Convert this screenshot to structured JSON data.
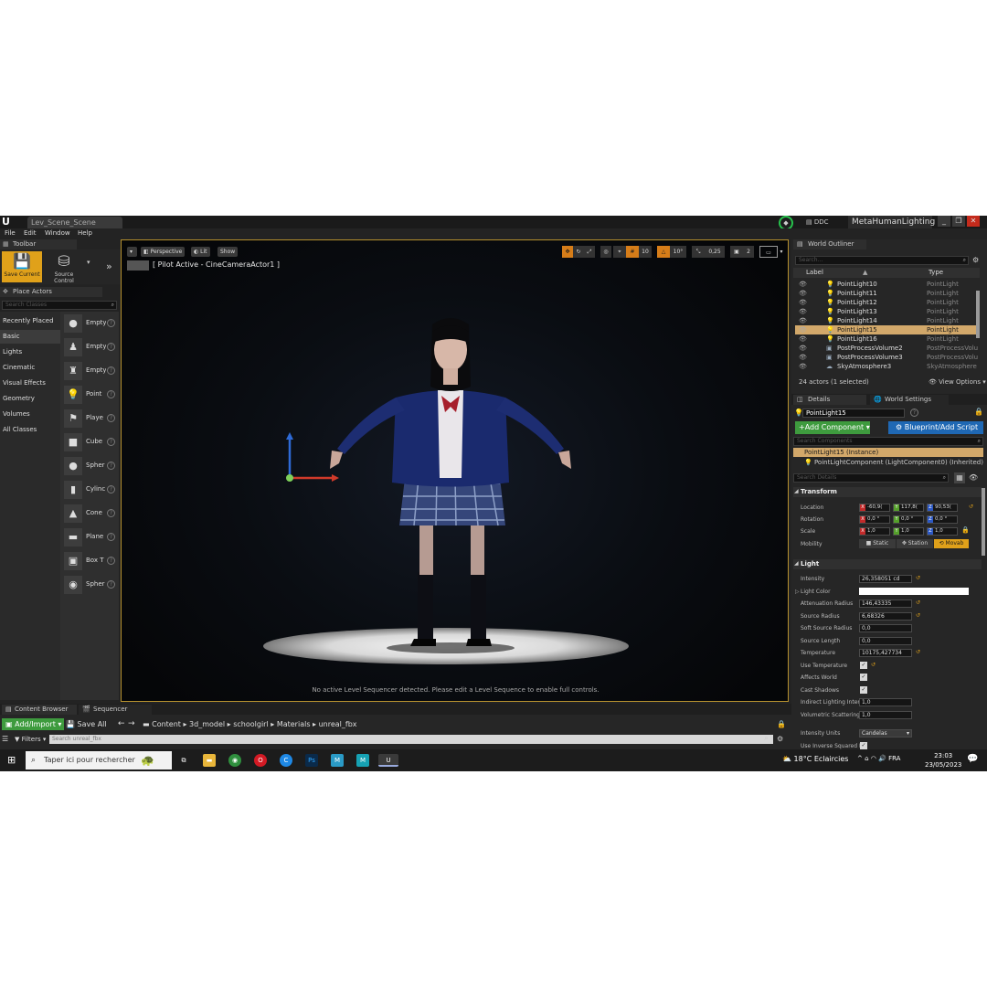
{
  "app": {
    "tab_title": "Lev_Scene_Scene",
    "ddc": "DDC",
    "project": "MetaHumanLighting",
    "window_buttons": [
      "_",
      "❐",
      "✕"
    ]
  },
  "menu": [
    "File",
    "Edit",
    "Window",
    "Help"
  ],
  "toolbar": {
    "tab": "Toolbar",
    "save_label": "Save Current",
    "source_label": "Source Control"
  },
  "place_actors": {
    "tab": "Place Actors",
    "search_placeholder": "Search Classes",
    "categories": [
      "Recently Placed",
      "Basic",
      "Lights",
      "Cinematic",
      "Visual Effects",
      "Geometry",
      "Volumes",
      "All Classes"
    ],
    "active_category": "Basic",
    "items": [
      {
        "name": "Empty",
        "icon": "●"
      },
      {
        "name": "Empty",
        "icon": "♟"
      },
      {
        "name": "Empty",
        "icon": "♜"
      },
      {
        "name": "Point",
        "icon": "💡"
      },
      {
        "name": "Playe",
        "icon": "⚑"
      },
      {
        "name": "Cube",
        "icon": "■"
      },
      {
        "name": "Spher",
        "icon": "●"
      },
      {
        "name": "Cylinc",
        "icon": "▮"
      },
      {
        "name": "Cone",
        "icon": "▲"
      },
      {
        "name": "Plane",
        "icon": "▬"
      },
      {
        "name": "Box T",
        "icon": "▣"
      },
      {
        "name": "Spher",
        "icon": "◉"
      }
    ]
  },
  "viewport": {
    "perspective": "Perspective",
    "lit": "Lit",
    "show": "Show",
    "pilot": "[ Pilot Active - CineCameraActor1 ]",
    "grid": "10",
    "angle": "10°",
    "scale": "0,25",
    "camera_speed": "2",
    "message": "No active Level Sequencer detected. Please edit a Level Sequence to enable full controls."
  },
  "outliner": {
    "tab": "World Outliner",
    "search_placeholder": "Search...",
    "col_label": "Label",
    "col_type": "Type",
    "rows": [
      {
        "label": "PointLight10",
        "type": "PointLight"
      },
      {
        "label": "PointLight11",
        "type": "PointLight"
      },
      {
        "label": "PointLight12",
        "type": "PointLight"
      },
      {
        "label": "PointLight13",
        "type": "PointLight"
      },
      {
        "label": "PointLight14",
        "type": "PointLight"
      },
      {
        "label": "PointLight15",
        "type": "PointLight"
      },
      {
        "label": "PointLight16",
        "type": "PointLight"
      },
      {
        "label": "PostProcessVolume2",
        "type": "PostProcessVolu"
      },
      {
        "label": "PostProcessVolume3",
        "type": "PostProcessVolu"
      },
      {
        "label": "SkyAtmosphere3",
        "type": "SkyAtmosphere"
      }
    ],
    "selected_index": 5,
    "count": "24 actors (1 selected)",
    "view_options": "View Options"
  },
  "details": {
    "tab_details": "Details",
    "tab_world": "World Settings",
    "name": "PointLight15",
    "add_component": "+Add Component",
    "blueprint": "Blueprint/Add Script",
    "comp_search_placeholder": "Search Components",
    "instance": "PointLight15 (Instance)",
    "component": "PointLightComponent (LightComponent0) (Inherited)",
    "details_search_placeholder": "Search Details",
    "transform": {
      "title": "Transform",
      "location_label": "Location",
      "location": [
        "-60,9(",
        "117,8(",
        "90,53("
      ],
      "rotation_label": "Rotation",
      "rotation": [
        "0,0 °",
        "0,0 °",
        "0,0 °"
      ],
      "scale_label": "Scale",
      "scale": [
        "1,0",
        "1,0",
        "1,0"
      ],
      "mobility_label": "Mobility",
      "mobility": [
        "Static",
        "Station",
        "Movab"
      ]
    },
    "light": {
      "title": "Light",
      "intensity_label": "Intensity",
      "intensity": "26,358051 cd",
      "light_color_label": "Light Color",
      "attenuation_label": "Attenuation Radius",
      "attenuation": "146,43335",
      "source_radius_label": "Source Radius",
      "source_radius": "6,68326",
      "soft_source_label": "Soft Source Radius",
      "soft_source": "0,0",
      "source_length_label": "Source Length",
      "source_length": "0,0",
      "temperature_label": "Temperature",
      "temperature": "10175,427734",
      "use_temp_label": "Use Temperature",
      "affects_world_label": "Affects World",
      "cast_shadows_label": "Cast Shadows",
      "indirect_label": "Indirect Lighting Inten",
      "indirect": "1,0",
      "volumetric_label": "Volumetric Scattering",
      "volumetric": "1,0",
      "units_label": "Intensity Units",
      "units": "Candelas",
      "inverse_label": "Use Inverse Squared F"
    }
  },
  "content_browser": {
    "tab": "Content Browser",
    "tab2": "Sequencer",
    "add_import": "Add/Import",
    "save_all": "Save All",
    "path": [
      "Content",
      "3d_model",
      "schoolgirl",
      "Materials",
      "unreal_fbx"
    ],
    "filters": "Filters",
    "search_placeholder": "Search unreal_fbx"
  },
  "taskbar": {
    "search": "Taper ici pour rechercher",
    "weather": "18°C  Eclaircies",
    "lang": "FRA",
    "time": "23:03",
    "date": "23/05/2023"
  },
  "colors": {
    "accent_orange": "#e0a11a",
    "selection": "#d2a86a",
    "green_button": "#3e9b3e",
    "blue_button": "#1f68b4"
  }
}
